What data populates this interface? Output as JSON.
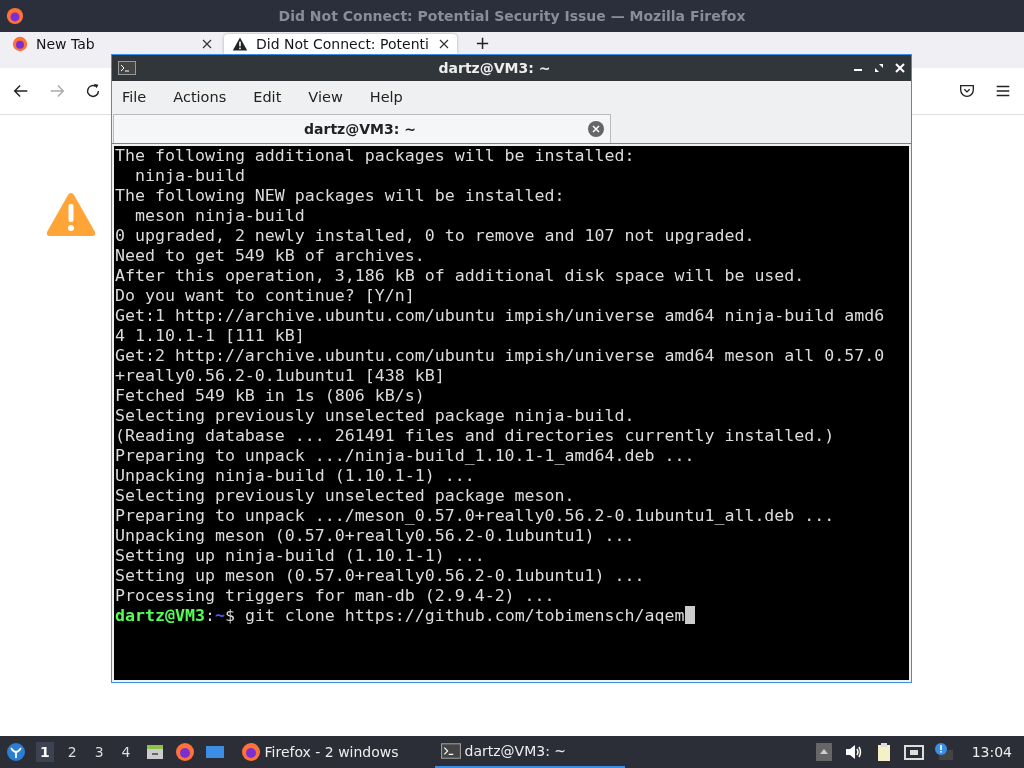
{
  "browser": {
    "title": "Did Not Connect: Potential Security Issue — Mozilla Firefox",
    "tabs": [
      {
        "label": "New Tab",
        "selected": false
      },
      {
        "label": "Did Not Connect: Potenti",
        "selected": true
      }
    ],
    "new_tab": "+"
  },
  "terminal": {
    "title": "dartz@VM3: ~",
    "menu": [
      "File",
      "Actions",
      "Edit",
      "View",
      "Help"
    ],
    "tab": {
      "label": "dartz@VM3: ~"
    },
    "lines": [
      "The following additional packages will be installed:",
      "  ninja-build",
      "The following NEW packages will be installed:",
      "  meson ninja-build",
      "0 upgraded, 2 newly installed, 0 to remove and 107 not upgraded.",
      "Need to get 549 kB of archives.",
      "After this operation, 3,186 kB of additional disk space will be used.",
      "Do you want to continue? [Y/n]",
      "Get:1 http://archive.ubuntu.com/ubuntu impish/universe amd64 ninja-build amd6",
      "4 1.10.1-1 [111 kB]",
      "Get:2 http://archive.ubuntu.com/ubuntu impish/universe amd64 meson all 0.57.0",
      "+really0.56.2-0.1ubuntu1 [438 kB]",
      "Fetched 549 kB in 1s (806 kB/s)",
      "Selecting previously unselected package ninja-build.",
      "(Reading database ... 261491 files and directories currently installed.)",
      "Preparing to unpack .../ninja-build_1.10.1-1_amd64.deb ...",
      "Unpacking ninja-build (1.10.1-1) ...",
      "Selecting previously unselected package meson.",
      "Preparing to unpack .../meson_0.57.0+really0.56.2-0.1ubuntu1_all.deb ...",
      "Unpacking meson (0.57.0+really0.56.2-0.1ubuntu1) ...",
      "Setting up ninja-build (1.10.1-1) ...",
      "Setting up meson (0.57.0+really0.56.2-0.1ubuntu1) ...",
      "Processing triggers for man-db (2.9.4-2) ..."
    ],
    "prompt": {
      "user_host": "dartz@VM3",
      "separator": ":",
      "path": "~",
      "symbol": "$",
      "command": " git clone https://github.com/tobimensch/aqem"
    }
  },
  "taskbar": {
    "workspaces": [
      {
        "label": "1",
        "selected": true
      },
      {
        "label": "2",
        "selected": false
      },
      {
        "label": "3",
        "selected": false
      },
      {
        "label": "4",
        "selected": false
      }
    ],
    "tasks": [
      {
        "label": "Firefox - 2 windows",
        "selected": false
      },
      {
        "label": "dartz@VM3: ~",
        "selected": true
      }
    ],
    "clock": "13:04"
  }
}
